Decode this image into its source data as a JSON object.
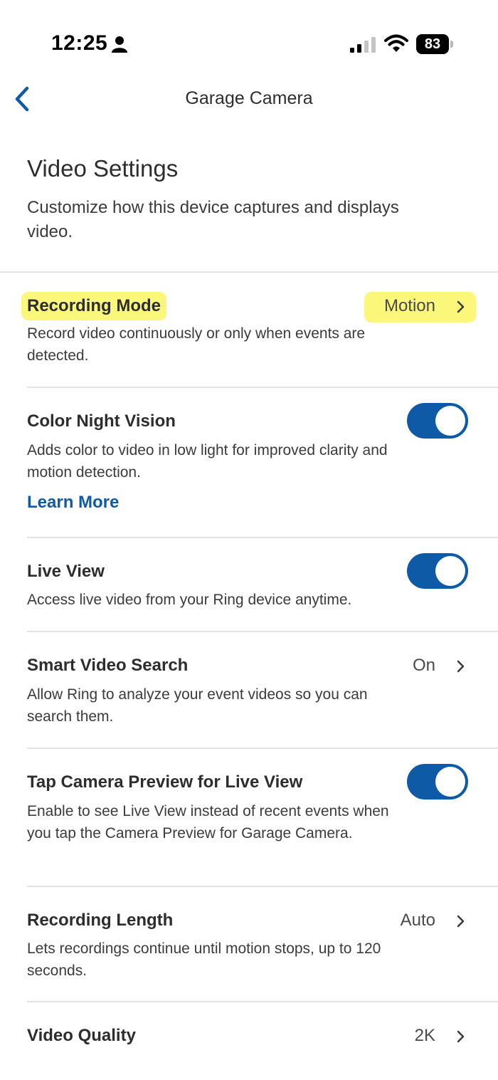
{
  "status_bar": {
    "time": "12:25",
    "battery": "83"
  },
  "nav": {
    "title": "Garage Camera"
  },
  "header": {
    "title": "Video Settings",
    "subtitle": "Customize how this device captures and displays video."
  },
  "settings": {
    "recording_mode": {
      "title": "Recording Mode",
      "value": "Motion",
      "description": "Record video continuously or only when events are detected."
    },
    "color_night_vision": {
      "title": "Color Night Vision",
      "enabled": true,
      "description": "Adds color to video in low light for improved clarity and motion detection.",
      "link": "Learn More"
    },
    "live_view": {
      "title": "Live View",
      "enabled": true,
      "description": "Access live video from your Ring device anytime."
    },
    "smart_video_search": {
      "title": "Smart Video Search",
      "value": "On",
      "description": "Allow Ring to analyze your event videos so you can search them."
    },
    "tap_camera_preview": {
      "title": "Tap Camera Preview for Live View",
      "enabled": true,
      "description": "Enable to see Live View instead of recent events when you tap the Camera Preview for Garage Camera."
    },
    "recording_length": {
      "title": "Recording Length",
      "value": "Auto",
      "description": "Lets recordings continue until motion stops, up to 120 seconds."
    },
    "video_quality": {
      "title": "Video Quality",
      "value": "2K"
    }
  },
  "colors": {
    "accent": "#0e5aa7",
    "highlight": "#fbf77a",
    "divider": "#e4e4e4"
  }
}
